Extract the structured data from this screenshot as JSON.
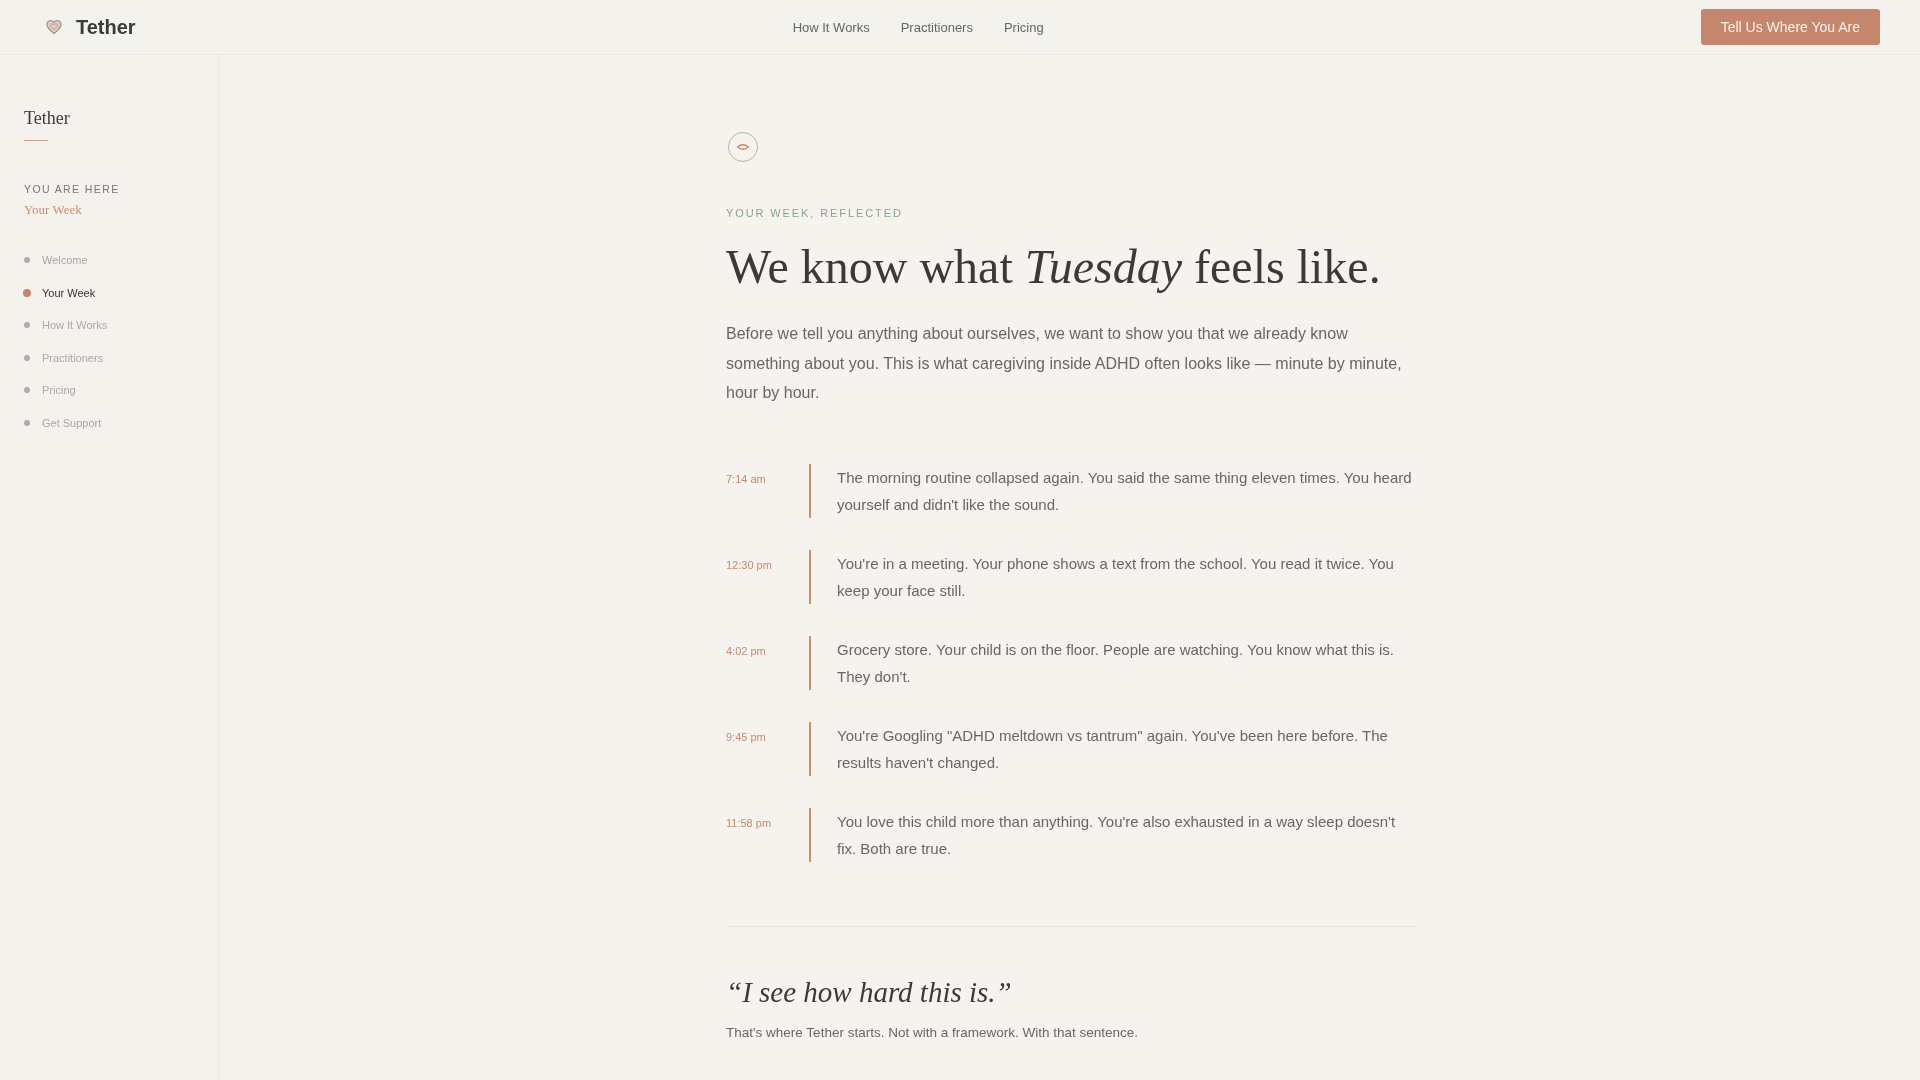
{
  "header": {
    "logo": "Tether",
    "nav": [
      "How It Works",
      "Practitioners",
      "Pricing"
    ],
    "cta": "Tell Us Where You Are"
  },
  "sidebar": {
    "title": "Tether",
    "location_label": "YOU ARE HERE",
    "location": "Your Week",
    "items": [
      {
        "label": "Welcome",
        "selected": false
      },
      {
        "label": "Your Week",
        "selected": true
      },
      {
        "label": "How It Works",
        "selected": false
      },
      {
        "label": "Practitioners",
        "selected": false
      },
      {
        "label": "Pricing",
        "selected": false
      },
      {
        "label": "Get Support",
        "selected": false
      }
    ]
  },
  "main": {
    "eyebrow": "YOUR WEEK, REFLECTED",
    "heading": "We know what *Tuesday* feels like.",
    "intro": "Before we tell you anything about ourselves, we want to show you that we already know something about you. This is what caregiving inside ADHD often looks like — minute by minute, hour by hour.",
    "timeline": [
      {
        "time": "7:14 am",
        "text": "The morning routine collapsed again. You said the same thing eleven times. You heard yourself and didn't like the sound."
      },
      {
        "time": "12:30 pm",
        "text": "You're in a meeting. Your phone shows a text from the school. You read it twice. You keep your face still."
      },
      {
        "time": "4:02 pm",
        "text": "Grocery store. Your child is on the floor. People are watching. You know what this is. They don't."
      },
      {
        "time": "9:45 pm",
        "text": "You're Googling \"ADHD meltdown vs tantrum\" again. You've been here before. The results haven't changed."
      },
      {
        "time": "11:58 pm",
        "text": "You love this child more than anything. You're also exhausted in a way sleep doesn't fix. Both are true."
      }
    ],
    "quote": "“I see how hard this is.”",
    "quote_caption": "That's where Tether starts. Not with a framework. With that sentence."
  }
}
